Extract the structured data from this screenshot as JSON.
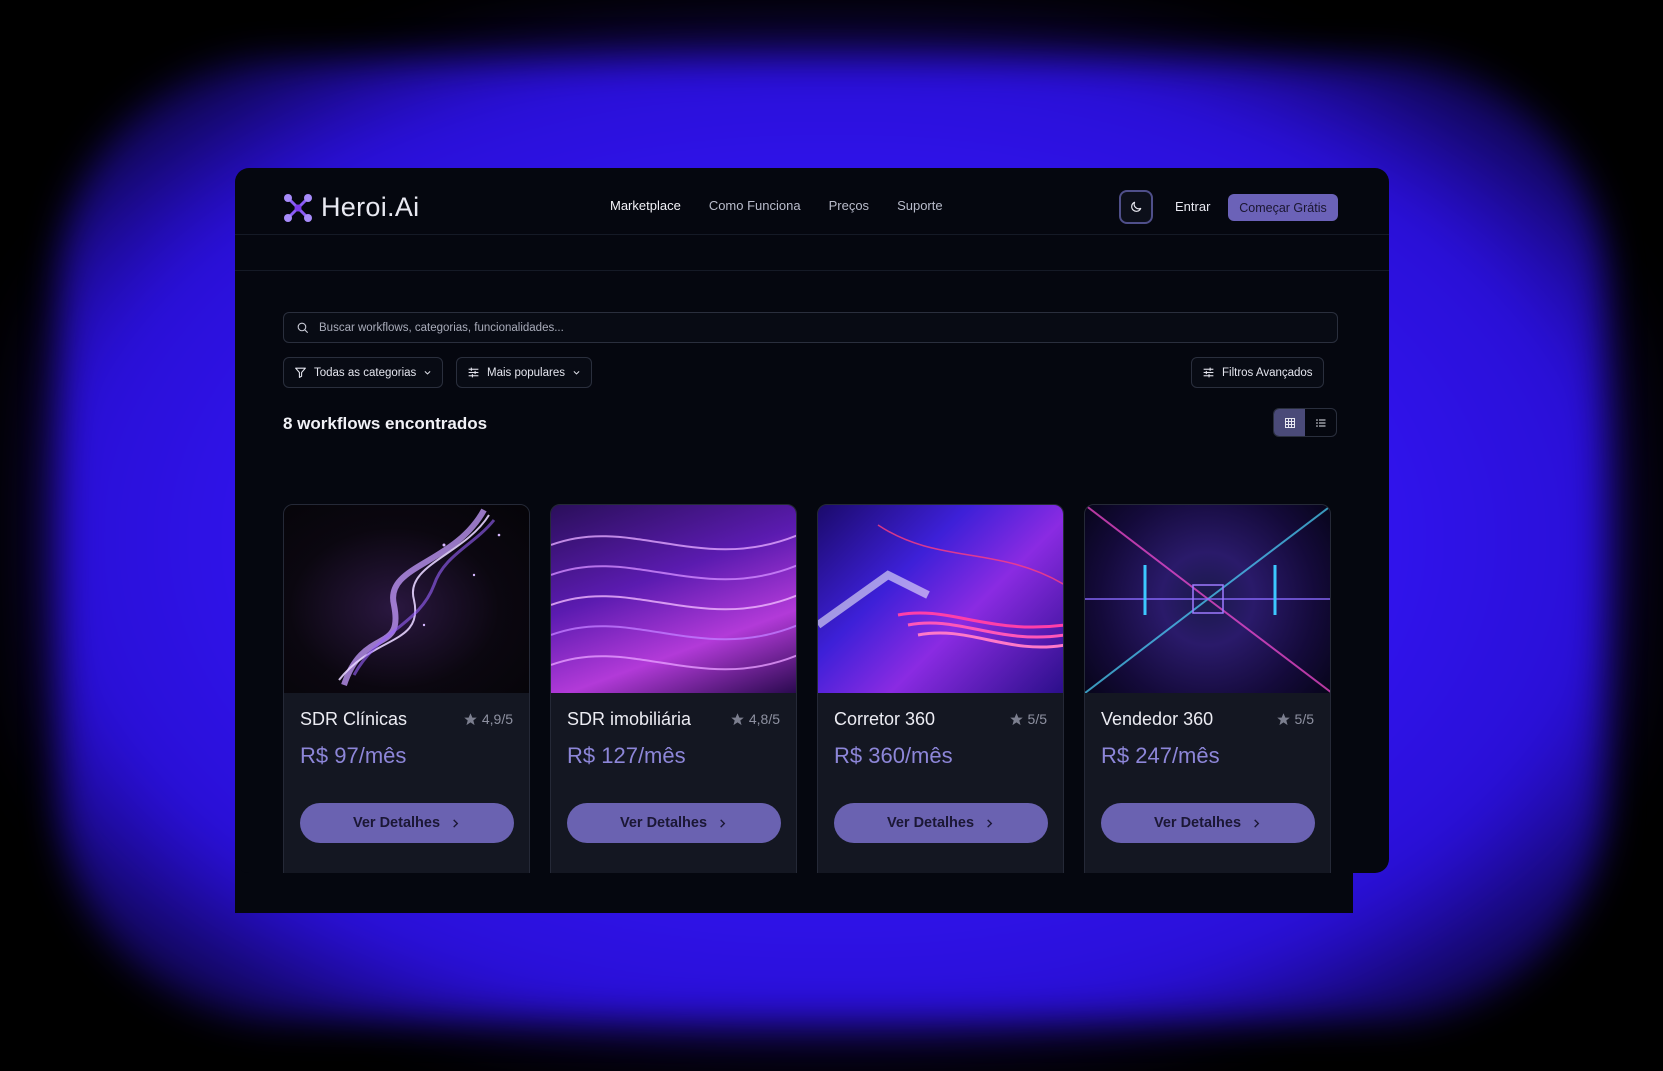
{
  "brand": {
    "name": "Heroi.Ai"
  },
  "nav": {
    "items": [
      "Marketplace",
      "Como Funciona",
      "Preços",
      "Suporte"
    ],
    "active": "Marketplace"
  },
  "header": {
    "login_label": "Entrar",
    "cta_label": "Começar Grátis"
  },
  "search": {
    "placeholder": "Buscar workflows, categorias, funcionalidades..."
  },
  "filters": {
    "category_label": "Todas as categorias",
    "sort_label": "Mais populares",
    "advanced_label": "Filtros Avançados"
  },
  "results": {
    "count_label": "8 workflows encontrados",
    "view_mode": "grid"
  },
  "cards": [
    {
      "title": "SDR Clínicas",
      "rating": "4,9/5",
      "price": "R$ 97/mês",
      "button": "Ver Detalhes"
    },
    {
      "title": "SDR imobiliária",
      "rating": "4,8/5",
      "price": "R$ 127/mês",
      "button": "Ver Detalhes"
    },
    {
      "title": "Corretor 360",
      "rating": "5/5",
      "price": "R$ 360/mês",
      "button": "Ver Detalhes"
    },
    {
      "title": "Vendedor 360",
      "rating": "5/5",
      "price": "R$ 247/mês",
      "button": "Ver Detalhes"
    }
  ],
  "colors": {
    "accent": "#6b62b8",
    "price": "#8d86d8",
    "glow": "#3214f2",
    "background": "#05070f"
  }
}
